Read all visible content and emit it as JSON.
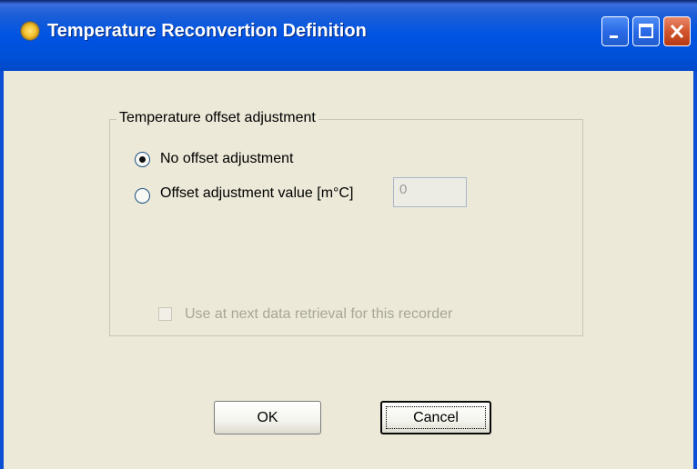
{
  "window": {
    "title": "Temperature Reconvertion Definition",
    "icon": "sun-app-icon",
    "controls": [
      "minimize",
      "maximize",
      "close"
    ],
    "accent_color": "#0054e3"
  },
  "group": {
    "label": "Temperature offset adjustment",
    "options": [
      {
        "label": "No offset adjustment",
        "selected": true
      },
      {
        "label": "Offset adjustment value [m°C]",
        "selected": false
      }
    ],
    "offset_value": "0",
    "checkbox_label": "Use at next data retrieval for this recorder",
    "checkbox_checked": false,
    "checkbox_enabled": false
  },
  "buttons": {
    "ok": "OK",
    "cancel": "Cancel"
  }
}
